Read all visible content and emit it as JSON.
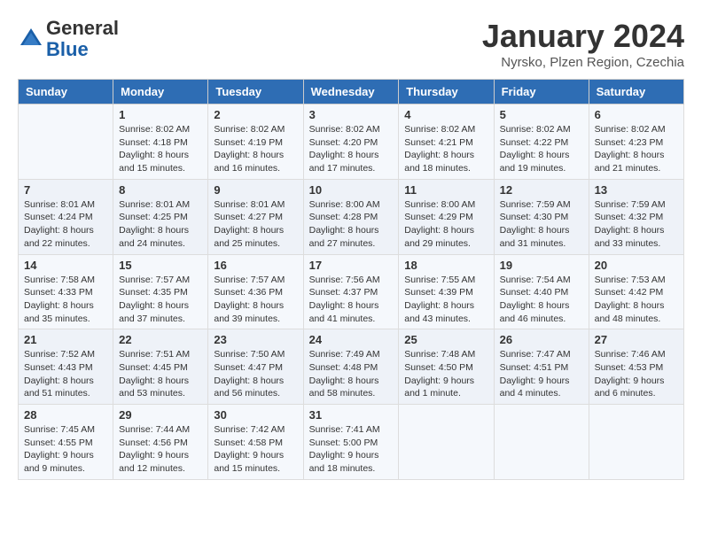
{
  "header": {
    "logo_general": "General",
    "logo_blue": "Blue",
    "month_title": "January 2024",
    "location": "Nyrsko, Plzen Region, Czechia"
  },
  "days_of_week": [
    "Sunday",
    "Monday",
    "Tuesday",
    "Wednesday",
    "Thursday",
    "Friday",
    "Saturday"
  ],
  "weeks": [
    [
      {
        "day": "",
        "content": ""
      },
      {
        "day": "1",
        "content": "Sunrise: 8:02 AM\nSunset: 4:18 PM\nDaylight: 8 hours\nand 15 minutes."
      },
      {
        "day": "2",
        "content": "Sunrise: 8:02 AM\nSunset: 4:19 PM\nDaylight: 8 hours\nand 16 minutes."
      },
      {
        "day": "3",
        "content": "Sunrise: 8:02 AM\nSunset: 4:20 PM\nDaylight: 8 hours\nand 17 minutes."
      },
      {
        "day": "4",
        "content": "Sunrise: 8:02 AM\nSunset: 4:21 PM\nDaylight: 8 hours\nand 18 minutes."
      },
      {
        "day": "5",
        "content": "Sunrise: 8:02 AM\nSunset: 4:22 PM\nDaylight: 8 hours\nand 19 minutes."
      },
      {
        "day": "6",
        "content": "Sunrise: 8:02 AM\nSunset: 4:23 PM\nDaylight: 8 hours\nand 21 minutes."
      }
    ],
    [
      {
        "day": "7",
        "content": "Sunrise: 8:01 AM\nSunset: 4:24 PM\nDaylight: 8 hours\nand 22 minutes."
      },
      {
        "day": "8",
        "content": "Sunrise: 8:01 AM\nSunset: 4:25 PM\nDaylight: 8 hours\nand 24 minutes."
      },
      {
        "day": "9",
        "content": "Sunrise: 8:01 AM\nSunset: 4:27 PM\nDaylight: 8 hours\nand 25 minutes."
      },
      {
        "day": "10",
        "content": "Sunrise: 8:00 AM\nSunset: 4:28 PM\nDaylight: 8 hours\nand 27 minutes."
      },
      {
        "day": "11",
        "content": "Sunrise: 8:00 AM\nSunset: 4:29 PM\nDaylight: 8 hours\nand 29 minutes."
      },
      {
        "day": "12",
        "content": "Sunrise: 7:59 AM\nSunset: 4:30 PM\nDaylight: 8 hours\nand 31 minutes."
      },
      {
        "day": "13",
        "content": "Sunrise: 7:59 AM\nSunset: 4:32 PM\nDaylight: 8 hours\nand 33 minutes."
      }
    ],
    [
      {
        "day": "14",
        "content": "Sunrise: 7:58 AM\nSunset: 4:33 PM\nDaylight: 8 hours\nand 35 minutes."
      },
      {
        "day": "15",
        "content": "Sunrise: 7:57 AM\nSunset: 4:35 PM\nDaylight: 8 hours\nand 37 minutes."
      },
      {
        "day": "16",
        "content": "Sunrise: 7:57 AM\nSunset: 4:36 PM\nDaylight: 8 hours\nand 39 minutes."
      },
      {
        "day": "17",
        "content": "Sunrise: 7:56 AM\nSunset: 4:37 PM\nDaylight: 8 hours\nand 41 minutes."
      },
      {
        "day": "18",
        "content": "Sunrise: 7:55 AM\nSunset: 4:39 PM\nDaylight: 8 hours\nand 43 minutes."
      },
      {
        "day": "19",
        "content": "Sunrise: 7:54 AM\nSunset: 4:40 PM\nDaylight: 8 hours\nand 46 minutes."
      },
      {
        "day": "20",
        "content": "Sunrise: 7:53 AM\nSunset: 4:42 PM\nDaylight: 8 hours\nand 48 minutes."
      }
    ],
    [
      {
        "day": "21",
        "content": "Sunrise: 7:52 AM\nSunset: 4:43 PM\nDaylight: 8 hours\nand 51 minutes."
      },
      {
        "day": "22",
        "content": "Sunrise: 7:51 AM\nSunset: 4:45 PM\nDaylight: 8 hours\nand 53 minutes."
      },
      {
        "day": "23",
        "content": "Sunrise: 7:50 AM\nSunset: 4:47 PM\nDaylight: 8 hours\nand 56 minutes."
      },
      {
        "day": "24",
        "content": "Sunrise: 7:49 AM\nSunset: 4:48 PM\nDaylight: 8 hours\nand 58 minutes."
      },
      {
        "day": "25",
        "content": "Sunrise: 7:48 AM\nSunset: 4:50 PM\nDaylight: 9 hours\nand 1 minute."
      },
      {
        "day": "26",
        "content": "Sunrise: 7:47 AM\nSunset: 4:51 PM\nDaylight: 9 hours\nand 4 minutes."
      },
      {
        "day": "27",
        "content": "Sunrise: 7:46 AM\nSunset: 4:53 PM\nDaylight: 9 hours\nand 6 minutes."
      }
    ],
    [
      {
        "day": "28",
        "content": "Sunrise: 7:45 AM\nSunset: 4:55 PM\nDaylight: 9 hours\nand 9 minutes."
      },
      {
        "day": "29",
        "content": "Sunrise: 7:44 AM\nSunset: 4:56 PM\nDaylight: 9 hours\nand 12 minutes."
      },
      {
        "day": "30",
        "content": "Sunrise: 7:42 AM\nSunset: 4:58 PM\nDaylight: 9 hours\nand 15 minutes."
      },
      {
        "day": "31",
        "content": "Sunrise: 7:41 AM\nSunset: 5:00 PM\nDaylight: 9 hours\nand 18 minutes."
      },
      {
        "day": "",
        "content": ""
      },
      {
        "day": "",
        "content": ""
      },
      {
        "day": "",
        "content": ""
      }
    ]
  ]
}
